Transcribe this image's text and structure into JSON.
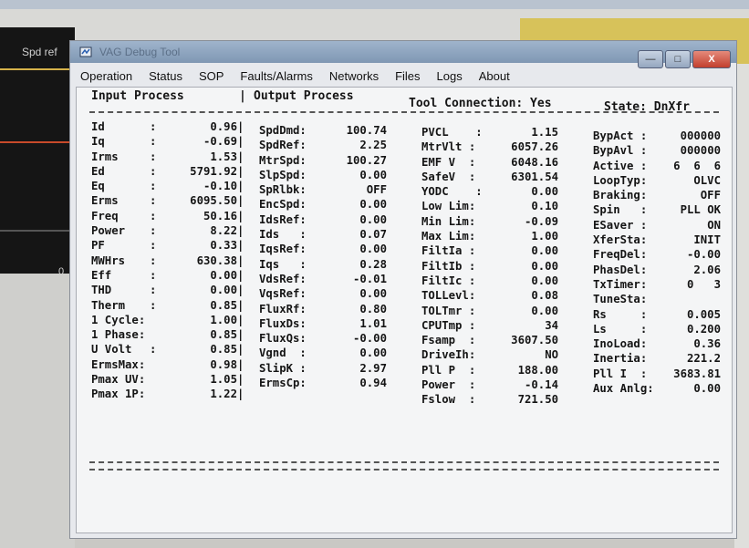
{
  "background": {
    "side_label": "Spd ref",
    "side_tick": "0"
  },
  "window": {
    "title": "VAG Debug Tool",
    "controls": {
      "minimize": "—",
      "maximize": "□",
      "close": "X"
    }
  },
  "menu": [
    "Operation",
    "Status",
    "SOP",
    "Faults/Alarms",
    "Networks",
    "Files",
    "Logs",
    "About"
  ],
  "header": {
    "input": "Input Process",
    "divider": "|",
    "output": "Output Process",
    "connection": "Tool Connection: Yes",
    "state": "State: DnXfr"
  },
  "columns": {
    "input": [
      {
        "label": "Id",
        "sep": ":",
        "value": "0.96"
      },
      {
        "label": "Iq",
        "sep": ":",
        "value": "-0.69"
      },
      {
        "label": "Irms",
        "sep": ":",
        "value": "1.53"
      },
      {
        "label": "Ed",
        "sep": ":",
        "value": "5791.92"
      },
      {
        "label": "Eq",
        "sep": ":",
        "value": "-0.10"
      },
      {
        "label": "Erms",
        "sep": ":",
        "value": "6095.50"
      },
      {
        "label": "Freq",
        "sep": ":",
        "value": "50.16"
      },
      {
        "label": "Power",
        "sep": ":",
        "value": "8.22"
      },
      {
        "label": "PF",
        "sep": ":",
        "value": "0.33"
      },
      {
        "label": "MWHrs",
        "sep": ":",
        "value": "630.38"
      },
      {
        "label": "Eff",
        "sep": ":",
        "value": "0.00"
      },
      {
        "label": "THD",
        "sep": ":",
        "value": "0.00"
      },
      {
        "label": "Therm",
        "sep": ":",
        "value": "0.85"
      },
      {
        "label": "1 Cycle:",
        "sep": "",
        "value": "1.00"
      },
      {
        "label": "1 Phase:",
        "sep": "",
        "value": "0.85"
      },
      {
        "label": "U Volt",
        "sep": ":",
        "value": "0.85"
      },
      {
        "label": "ErmsMax:",
        "sep": "",
        "value": "0.98"
      },
      {
        "label": "Pmax UV:",
        "sep": "",
        "value": "1.05"
      },
      {
        "label": "Pmax 1P:",
        "sep": "",
        "value": "1.22"
      }
    ],
    "output": [
      {
        "label": "SpdDmd:",
        "value": "100.74"
      },
      {
        "label": "SpdRef:",
        "value": "2.25"
      },
      {
        "label": "MtrSpd:",
        "value": "100.27"
      },
      {
        "label": "SlpSpd:",
        "value": "0.00"
      },
      {
        "label": "SpRlbk:",
        "value": "OFF"
      },
      {
        "label": "EncSpd:",
        "value": "0.00"
      },
      {
        "label": "IdsRef:",
        "value": "0.00"
      },
      {
        "label": "Ids   :",
        "value": "0.07"
      },
      {
        "label": "IqsRef:",
        "value": "0.00"
      },
      {
        "label": "Iqs   :",
        "value": "0.28"
      },
      {
        "label": "VdsRef:",
        "value": "-0.01"
      },
      {
        "label": "VqsRef:",
        "value": "0.00"
      },
      {
        "label": "FluxRf:",
        "value": "0.80"
      },
      {
        "label": "FluxDs:",
        "value": "1.01"
      },
      {
        "label": "FluxQs:",
        "value": "-0.00"
      },
      {
        "label": "Vgnd  :",
        "value": "0.00"
      },
      {
        "label": "SlipK :",
        "value": "2.97"
      },
      {
        "label": "ErmsCp:",
        "value": "0.94"
      }
    ],
    "third": [
      {
        "label": "PVCL    :",
        "value": "1.15"
      },
      {
        "label": "MtrVlt :",
        "value": "6057.26"
      },
      {
        "label": "EMF V  :",
        "value": "6048.16"
      },
      {
        "label": "SafeV  :",
        "value": "6301.54"
      },
      {
        "label": "YODC    :",
        "value": "0.00"
      },
      {
        "label": "Low Lim:",
        "value": "0.10"
      },
      {
        "label": "Min Lim:",
        "value": "-0.09"
      },
      {
        "label": "Max Lim:",
        "value": "1.00"
      },
      {
        "label": "FiltIa :",
        "value": "0.00"
      },
      {
        "label": "FiltIb :",
        "value": "0.00"
      },
      {
        "label": "FiltIc :",
        "value": "0.00"
      },
      {
        "label": "TOLLevl:",
        "value": "0.08"
      },
      {
        "label": "TOLTmr :",
        "value": "0.00"
      },
      {
        "label": "CPUTmp :",
        "value": "34"
      },
      {
        "label": "Fsamp  :",
        "value": "3607.50"
      },
      {
        "label": "DriveIh:",
        "value": "NO"
      },
      {
        "label": "Pll P  :",
        "value": "188.00"
      },
      {
        "label": "Power  :",
        "value": "-0.14"
      },
      {
        "label": "Fslow  :",
        "value": "721.50"
      }
    ],
    "fourth": [
      {
        "label": "BypAct :",
        "value": "000000"
      },
      {
        "label": "BypAvl :",
        "value": "000000"
      },
      {
        "label": "Active :",
        "value": "6  6  6"
      },
      {
        "label": "LoopTyp:",
        "value": "OLVC"
      },
      {
        "label": "Braking:",
        "value": "OFF"
      },
      {
        "label": "Spin   :",
        "value": "PLL OK"
      },
      {
        "label": "ESaver :",
        "value": "ON"
      },
      {
        "label": "XferSta:",
        "value": "INIT"
      },
      {
        "label": "FreqDel:",
        "value": "-0.00"
      },
      {
        "label": "PhasDel:",
        "value": "2.06"
      },
      {
        "label": "TxTimer:",
        "value": "0   3"
      },
      {
        "label": "TuneSta:",
        "value": ""
      },
      {
        "label": "Rs     :",
        "value": "0.005"
      },
      {
        "label": "Ls     :",
        "value": "0.200"
      },
      {
        "label": "InoLoad:",
        "value": "0.36"
      },
      {
        "label": "Inertia:",
        "value": "221.2"
      },
      {
        "label": "Pll I  :",
        "value": "3683.81"
      },
      {
        "label": "Aux Anlg:",
        "value": "0.00"
      }
    ]
  }
}
